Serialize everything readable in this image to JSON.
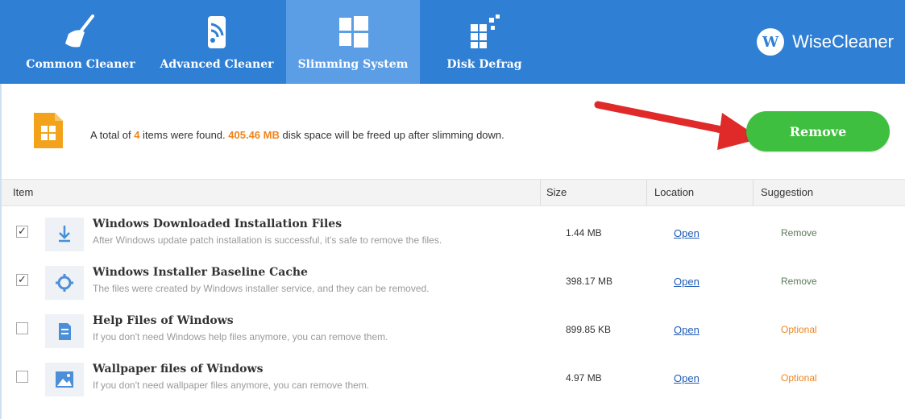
{
  "header": {
    "tabs": [
      {
        "label": "Common Cleaner",
        "icon": "broom-icon",
        "active": false
      },
      {
        "label": "Advanced Cleaner",
        "icon": "sweep-icon",
        "active": false
      },
      {
        "label": "Slimming System",
        "icon": "windows-icon",
        "active": true
      },
      {
        "label": "Disk Defrag",
        "icon": "defrag-icon",
        "active": false
      }
    ],
    "brand": {
      "logo_letter": "W",
      "name": "WiseCleaner"
    }
  },
  "summary": {
    "prefix": "A total of ",
    "count": "4",
    "middle": " items were found. ",
    "space": "405.46 MB",
    "suffix": " disk space will be freed up after slimming down.",
    "remove_label": "Remove"
  },
  "table": {
    "columns": {
      "item": "Item",
      "size": "Size",
      "location": "Location",
      "suggestion": "Suggestion"
    },
    "rows": [
      {
        "checked": true,
        "icon": "download-icon",
        "title": "Windows Downloaded Installation Files",
        "desc": "After Windows update patch installation is successful, it's safe to remove the files.",
        "size": "1.44 MB",
        "location": "Open",
        "suggestion": "Remove"
      },
      {
        "checked": true,
        "icon": "gear-icon",
        "title": "Windows Installer Baseline Cache",
        "desc": "The files were created by Windows installer service, and they can be removed.",
        "size": "398.17 MB",
        "location": "Open",
        "suggestion": "Remove"
      },
      {
        "checked": false,
        "icon": "help-file-icon",
        "title": "Help Files of Windows",
        "desc": "If you don't need Windows help files anymore, you can remove them.",
        "size": "899.85 KB",
        "location": "Open",
        "suggestion": "Optional"
      },
      {
        "checked": false,
        "icon": "image-icon",
        "title": "Wallpaper files of Windows",
        "desc": "If you don't need wallpaper files anymore, you can remove them.",
        "size": "4.97 MB",
        "location": "Open",
        "suggestion": "Optional"
      }
    ]
  },
  "colors": {
    "header_bg": "#2f7fd4",
    "active_tab_bg": "#5c9ee6",
    "remove_button": "#3fbf3f",
    "highlight": "#f0841b",
    "suggestion_remove": "#5a7a5a",
    "suggestion_optional": "#f0841b",
    "link": "#1f5bb5"
  }
}
